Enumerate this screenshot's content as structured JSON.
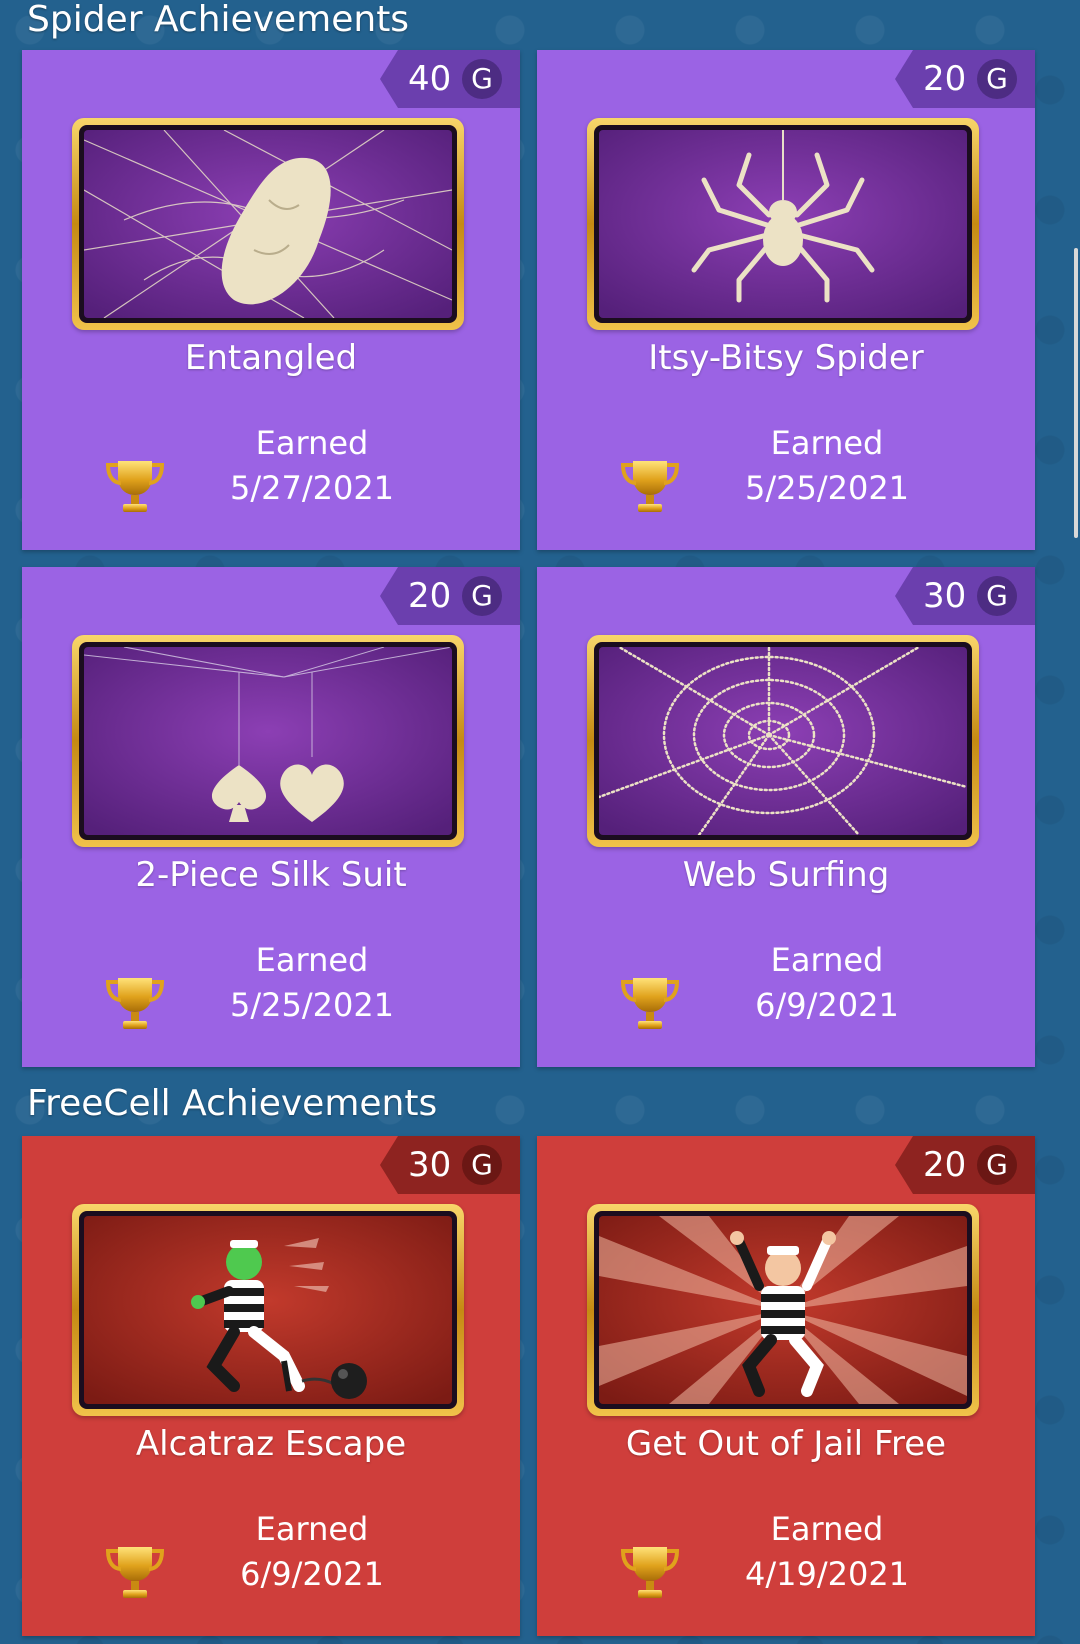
{
  "sections": [
    {
      "title": "Spider Achievements",
      "cards": [
        {
          "title": "Entangled",
          "points": "40",
          "currency": "G",
          "status": "Earned",
          "date": "5/27/2021",
          "art": "cocoon-web-icon"
        },
        {
          "title": "Itsy-Bitsy Spider",
          "points": "20",
          "currency": "G",
          "status": "Earned",
          "date": "5/25/2021",
          "art": "hanging-spider-icon"
        },
        {
          "title": "2-Piece Silk Suit",
          "points": "20",
          "currency": "G",
          "status": "Earned",
          "date": "5/25/2021",
          "art": "spade-heart-icon"
        },
        {
          "title": "Web Surfing",
          "points": "30",
          "currency": "G",
          "status": "Earned",
          "date": "6/9/2021",
          "art": "spider-web-icon"
        }
      ]
    },
    {
      "title": "FreeCell Achievements",
      "cards": [
        {
          "title": "Alcatraz Escape",
          "points": "30",
          "currency": "G",
          "status": "Earned",
          "date": "6/9/2021",
          "art": "running-prisoner-icon"
        },
        {
          "title": "Get Out of Jail Free",
          "points": "20",
          "currency": "G",
          "status": "Earned",
          "date": "4/19/2021",
          "art": "cheering-prisoner-icon"
        }
      ]
    }
  ],
  "colors": {
    "background": "#23618e",
    "spider_card": "#9b63e4",
    "spider_badge": "#6b3fae",
    "freecell_card": "#cf3e3b",
    "freecell_badge": "#8e2320",
    "frame_gold": "#e3b037"
  },
  "icons": {
    "trophy": "trophy-icon"
  }
}
